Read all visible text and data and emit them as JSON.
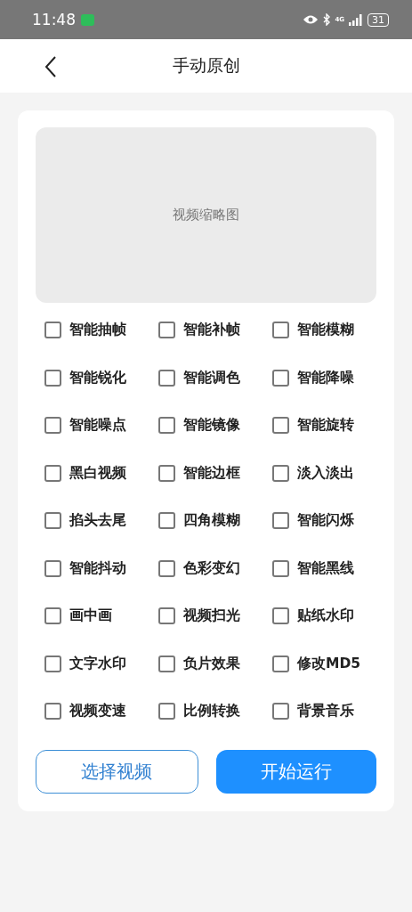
{
  "status_bar": {
    "time": "11:48",
    "network": "4G",
    "battery": "31"
  },
  "header": {
    "title": "手动原创"
  },
  "thumbnail": {
    "label": "视频缩略图"
  },
  "options": [
    {
      "label": "智能抽帧",
      "checked": false
    },
    {
      "label": "智能补帧",
      "checked": false
    },
    {
      "label": "智能模糊",
      "checked": false
    },
    {
      "label": "智能锐化",
      "checked": false
    },
    {
      "label": "智能调色",
      "checked": false
    },
    {
      "label": "智能降噪",
      "checked": false
    },
    {
      "label": "智能噪点",
      "checked": false
    },
    {
      "label": "智能镜像",
      "checked": false
    },
    {
      "label": "智能旋转",
      "checked": false
    },
    {
      "label": "黑白视频",
      "checked": false
    },
    {
      "label": "智能边框",
      "checked": false
    },
    {
      "label": "淡入淡出",
      "checked": false
    },
    {
      "label": "掐头去尾",
      "checked": false
    },
    {
      "label": "四角模糊",
      "checked": false
    },
    {
      "label": "智能闪烁",
      "checked": false
    },
    {
      "label": "智能抖动",
      "checked": false
    },
    {
      "label": "色彩变幻",
      "checked": false
    },
    {
      "label": "智能黑线",
      "checked": false
    },
    {
      "label": "画中画",
      "checked": false
    },
    {
      "label": "视频扫光",
      "checked": false
    },
    {
      "label": "贴纸水印",
      "checked": false
    },
    {
      "label": "文字水印",
      "checked": false
    },
    {
      "label": "负片效果",
      "checked": false
    },
    {
      "label": "修改MD5",
      "checked": false
    },
    {
      "label": "视频变速",
      "checked": false
    },
    {
      "label": "比例转换",
      "checked": false
    },
    {
      "label": "背景音乐",
      "checked": false
    }
  ],
  "buttons": [
    {
      "label": "选择视频",
      "kind": "outline"
    },
    {
      "label": "开始运行",
      "kind": "primary"
    }
  ]
}
